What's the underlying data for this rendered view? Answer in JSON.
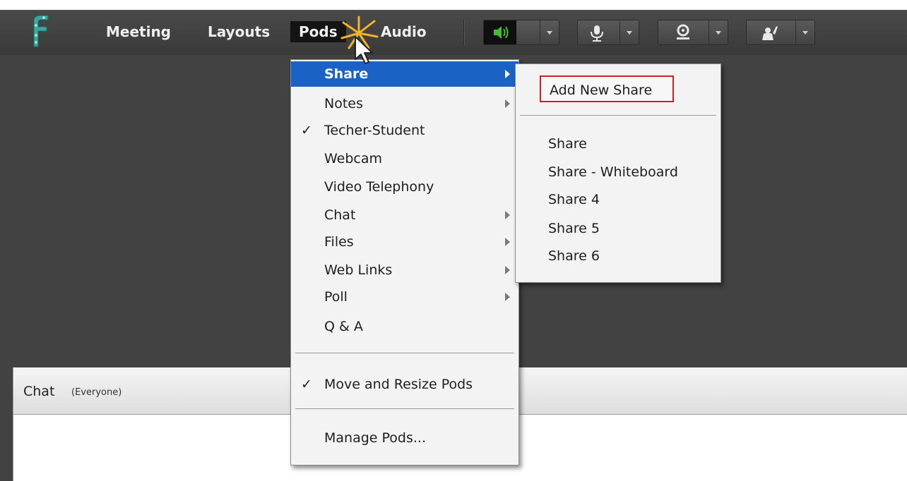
{
  "menubar": {
    "items": [
      {
        "label": "Meeting"
      },
      {
        "label": "Layouts"
      },
      {
        "label": "Pods"
      },
      {
        "label": "Audio"
      }
    ]
  },
  "pods_menu": {
    "items": [
      {
        "label": "Share",
        "checked": false,
        "has_submenu": true,
        "highlighted": true
      },
      {
        "label": "Notes",
        "checked": false,
        "has_submenu": true
      },
      {
        "label": "Techer-Student",
        "checked": true,
        "has_submenu": false
      },
      {
        "label": "Webcam",
        "checked": false,
        "has_submenu": false
      },
      {
        "label": "Video Telephony",
        "checked": false,
        "has_submenu": false
      },
      {
        "label": "Chat",
        "checked": false,
        "has_submenu": true
      },
      {
        "label": "Files",
        "checked": false,
        "has_submenu": true
      },
      {
        "label": "Web Links",
        "checked": false,
        "has_submenu": true
      },
      {
        "label": "Poll",
        "checked": false,
        "has_submenu": true
      },
      {
        "label": "Q & A",
        "checked": false,
        "has_submenu": false
      },
      {
        "label": "Move and Resize Pods",
        "checked": true,
        "has_submenu": false
      },
      {
        "label": "Manage Pods...",
        "checked": false,
        "has_submenu": false
      }
    ],
    "check_glyph": "✓"
  },
  "share_submenu": {
    "add_new": "Add New Share",
    "items": [
      "Share",
      "Share - Whiteboard",
      "Share 4",
      "Share 5",
      "Share 6"
    ]
  },
  "chat_pod": {
    "title": "Chat",
    "subtitle": "(Everyone)"
  },
  "icons": {
    "logo": "adobe-connect-logo-icon",
    "speaker": "speaker-icon",
    "microphone": "microphone-icon",
    "webcam": "webcam-icon",
    "raise_hand": "raise-hand-icon"
  },
  "colors": {
    "highlight": "#1a63c4",
    "speaker_active": "#3fbf2a",
    "callout_border": "#d11f1f",
    "toolbar_bg": "#424242"
  }
}
